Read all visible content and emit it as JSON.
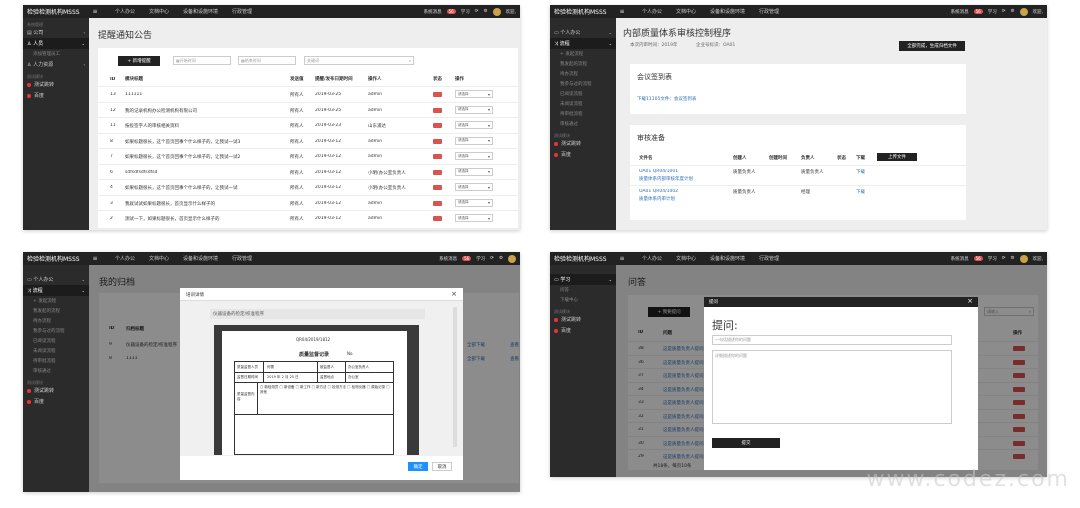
{
  "app": {
    "brand": "检验检测机构MSSS",
    "nav": [
      "个人办公",
      "文档中心",
      "设备和设施环境",
      "行政管理"
    ],
    "msg": "系统消息",
    "msg_count": "56",
    "study": "学习",
    "user": "欢迎,"
  },
  "p1": {
    "side": [
      {
        "label": "公司",
        "car": "‹"
      },
      {
        "label": "人员",
        "car": "⌄",
        "active": true
      },
      {
        "label": "添加管理员工",
        "sub": true
      },
      {
        "label": "人力资源",
        "car": "‹"
      }
    ],
    "side_head1": "系统管理",
    "side_head2": "测试模块",
    "side_extra": [
      "测试跳转",
      "百度"
    ],
    "title": "提醒通知公告",
    "add": "+ 新增提醒",
    "start_ph": "开始时间",
    "end_ph": "结束时间",
    "search_ph": "关键词",
    "cols": [
      "ID",
      "模块标题",
      "发送值",
      "提醒/发布日期时间",
      "操作人",
      "状态",
      "操作"
    ],
    "rows": [
      [
        "13",
        "111111",
        "所有人",
        "2019-03-25",
        "admin"
      ],
      [
        "12",
        "我的记录机构办公检测机构有限公司",
        "所有人",
        "2019-03-25",
        "admin"
      ],
      [
        "11",
        "按投签字人的审核相关资料",
        "所有人",
        "2019-03-23",
        "山东浦达"
      ],
      [
        "8",
        "如果标题很长，这个首页回事个什么样子的，让我试一试3",
        "所有人",
        "2019-03-12",
        "admin"
      ],
      [
        "7",
        "如果标题很长，这个首页回事个什么样子的，让我试一试2",
        "所有人",
        "2019-03-12",
        "admin"
      ],
      [
        "6",
        "sdfsdfsdfsdfsd",
        "所有人",
        "2019-03-12",
        "小明(办公室负责人"
      ],
      [
        "4",
        "如果标题很长，这个首页回事个什么样子的，让我试一试",
        "所有人",
        "2019-03-12",
        "小明(办公室负责人"
      ],
      [
        "3",
        "我就试试如果标题很长，首页显示什么样子的",
        "所有人",
        "2019-03-12",
        "admin"
      ],
      [
        "2",
        "测试一下，如果标题很长，首页显示什么样子的",
        "所有人",
        "2019-03-12",
        "admin"
      ]
    ],
    "sel": "请选择"
  },
  "p2": {
    "side": [
      {
        "label": "个人办公",
        "car": "⌄"
      },
      {
        "label": "流程",
        "car": "⌄",
        "active": true
      }
    ],
    "subs": [
      "+ 发起流程",
      "我发起的流程",
      "待办流程",
      "我参与过的流程",
      "已阅读流程",
      "未阅读流程",
      "待审批流程",
      "审核通过"
    ],
    "side_head": "测试模块",
    "side_extra": [
      "测试跳转",
      "百度"
    ],
    "title": "内部质量体系审核控制程序",
    "meta1": "本次内审时间：2019年",
    "meta2": "企业号标识：OA01",
    "btn": "全部完成，生成归档文件",
    "sec1": "会议签到表",
    "dl": "下载11105文件：会议签到表",
    "sec2": "审核准备",
    "cols": [
      "文件名",
      "创建人",
      "创建时间",
      "负责人",
      "状态",
      "下载"
    ],
    "upload": "上传文件",
    "rows": [
      [
        "OA01 QR04/1001",
        "质量体系内部审核年度计划",
        "质量负责人",
        "质量负责人",
        "下载"
      ],
      [
        "OA01 QR04/1002",
        "质量体系内审计划",
        "质量负责人",
        "经理",
        "下载"
      ]
    ]
  },
  "p3": {
    "side": [
      {
        "label": "个人办公",
        "car": "⌄"
      },
      {
        "label": "流程",
        "car": "⌄",
        "active": true
      }
    ],
    "subs": [
      "+ 发起流程",
      "我发起的流程",
      "待办流程",
      "我参与过的流程",
      "已阅读流程",
      "未阅读流程",
      "待审批流程",
      "审核通过"
    ],
    "side_head": "测试模块",
    "side_extra": [
      "测试跳转",
      "百度"
    ],
    "title": "我的归档",
    "cols": [
      "ID",
      "归档标题"
    ],
    "rows": [
      [
        "9",
        "仪器设备的检定/校准程序"
      ],
      [
        "8",
        "1111"
      ]
    ],
    "dl": "全部下载",
    "view": "查看",
    "modal_title": "培训详情",
    "doc_title": "仪器设备的检定/校准程序",
    "doc_code": "QR04/2019/1812",
    "doc_heading": "质量监督记录",
    "doc_no": "No.",
    "f1": "质量监督人员",
    "f1v": "何蕾",
    "f2": "被监督人",
    "f2v": "办公室负责人",
    "f3": "监督日期时间",
    "f3v": "2019 年 2 月 25 日",
    "f4": "监督地点",
    "f4v": "办公室",
    "f5": "质量监督内容",
    "f5v": "□ 新检测员 □ 新设备 □ 新工作 □ 新方法 □ 检测方法 □ 检测仪器 □ 原始记录 □ 其他",
    "ok": "确定",
    "cancel": "取消"
  },
  "p4": {
    "side": [
      {
        "label": "学习",
        "car": "⌄",
        "active": true
      }
    ],
    "subs": [
      "问答",
      "下载中心"
    ],
    "side_head": "测试模块",
    "side_extra": [
      "测试跳转",
      "百度"
    ],
    "title": "问答",
    "add": "+ 我要提问",
    "cols": [
      "ID",
      "问题",
      "操作"
    ],
    "search_ph": "请输入",
    "rows": [
      [
        "38",
        "这是质量负责人提问的问题"
      ],
      [
        "36",
        "这是质量负责人提问的问题"
      ],
      [
        "37",
        "这是质量负责人提问的问题"
      ],
      [
        "34",
        "这是质量负责人提问的问题"
      ],
      [
        "33",
        "这是质量负责人提问的问题"
      ],
      [
        "32",
        "这是质量负责人提问的问题"
      ],
      [
        "31",
        "这是质量负责人提问的问题"
      ],
      [
        "30",
        "这是质量负责人提问的问题"
      ],
      [
        "29",
        "这是质量负责人提问的问题"
      ]
    ],
    "footer": "共18条，每页10条",
    "modal_title": "提问",
    "heading": "提问:",
    "ph1": "一句话描述你的问题",
    "ph2": "详细描述你的问题",
    "submit": "提交"
  },
  "watermark": "www.codez.com"
}
